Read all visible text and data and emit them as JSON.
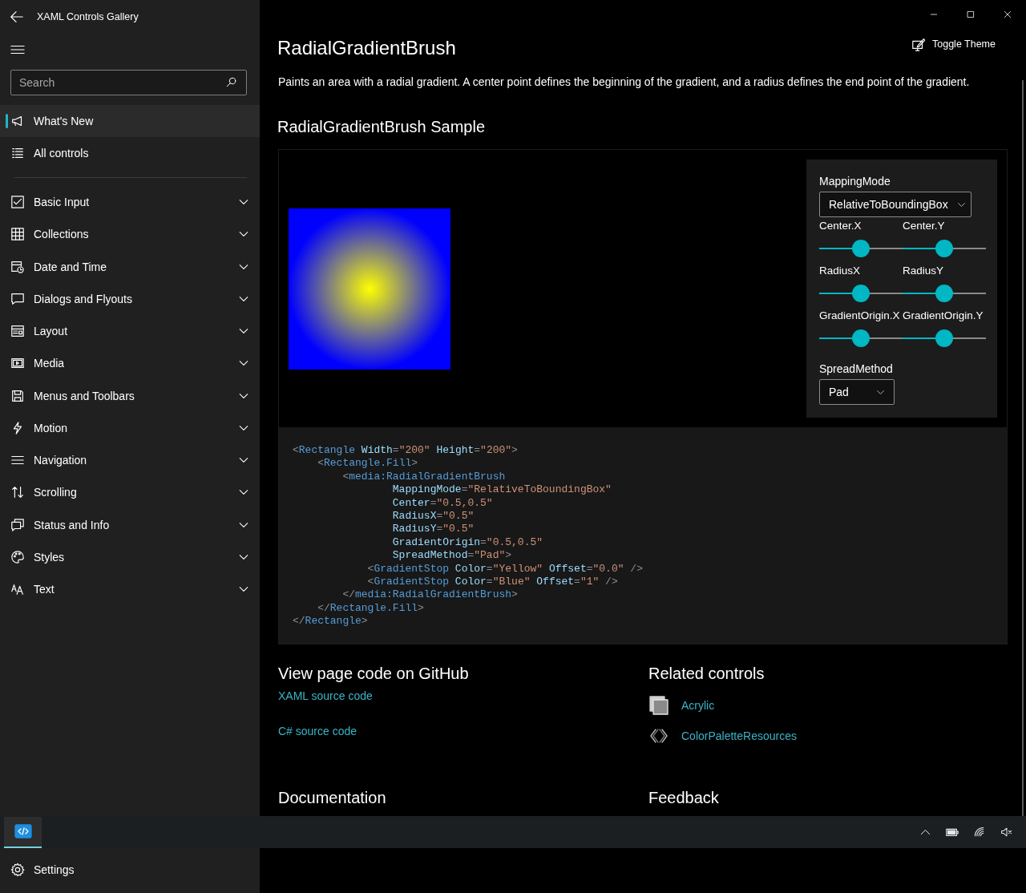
{
  "window": {
    "title": "XAML Controls Gallery"
  },
  "sidebar": {
    "search": {
      "placeholder": "Search"
    },
    "items": [
      {
        "label": "What's New",
        "selected": true
      },
      {
        "label": "All controls",
        "selected": false
      }
    ],
    "categories": [
      {
        "label": "Basic Input",
        "expanded": false,
        "selected": false
      },
      {
        "label": "Collections",
        "expanded": false,
        "selected": false
      },
      {
        "label": "Date and Time",
        "expanded": false,
        "selected": false
      },
      {
        "label": "Dialogs and Flyouts",
        "expanded": false,
        "selected": false
      },
      {
        "label": "Layout",
        "expanded": false,
        "selected": false
      },
      {
        "label": "Media",
        "expanded": false,
        "selected": false
      },
      {
        "label": "Menus and Toolbars",
        "expanded": false,
        "selected": false
      },
      {
        "label": "Motion",
        "expanded": false,
        "selected": false
      },
      {
        "label": "Navigation",
        "expanded": false,
        "selected": false
      },
      {
        "label": "Scrolling",
        "expanded": false,
        "selected": false
      },
      {
        "label": "Status and Info",
        "expanded": false,
        "selected": false
      },
      {
        "label": "Styles",
        "expanded": false,
        "selected": false
      },
      {
        "label": "Text",
        "expanded": false,
        "selected": false
      }
    ],
    "settings": {
      "label": "Settings"
    }
  },
  "page": {
    "title": "RadialGradientBrush",
    "toggle_theme": "Toggle Theme",
    "description": "Paints an area with a radial gradient. A center point defines the beginning of the gradient, and a radius defines the end point of the gradient.",
    "sample": {
      "heading": "RadialGradientBrush Sample",
      "options": {
        "mapping_mode": {
          "label": "MappingMode",
          "value": "RelativeToBoundingBox"
        },
        "sliders": [
          {
            "label": "Center.X",
            "level": 0.5
          },
          {
            "label": "Center.Y",
            "level": 0.5
          },
          {
            "label": "RadiusX",
            "level": 0.5
          },
          {
            "label": "RadiusY",
            "level": 0.5
          },
          {
            "label": "GradientOrigin.X",
            "level": 0.5
          },
          {
            "label": "GradientOrigin.Y",
            "level": 0.5
          }
        ],
        "spread_method": {
          "label": "SpreadMethod",
          "value": "Pad"
        }
      },
      "code": [
        [
          {
            "kind": "punct",
            "text": "<"
          },
          {
            "kind": "tag",
            "text": "Rectangle"
          },
          {
            "kind": "attr",
            "text": " Width"
          },
          {
            "kind": "punct",
            "text": "="
          },
          {
            "kind": "value",
            "text": "\"200\""
          },
          {
            "kind": "attr",
            "text": " Height"
          },
          {
            "kind": "punct",
            "text": "="
          },
          {
            "kind": "value",
            "text": "\"200\""
          },
          {
            "kind": "punct",
            "text": ">"
          }
        ],
        [
          {
            "kind": "punct",
            "text": "    <"
          },
          {
            "kind": "tag",
            "text": "Rectangle.Fill"
          },
          {
            "kind": "punct",
            "text": ">"
          }
        ],
        [
          {
            "kind": "punct",
            "text": "        <"
          },
          {
            "kind": "tag",
            "text": "media:RadialGradientBrush"
          }
        ],
        [
          {
            "kind": "attr",
            "text": "                MappingMode"
          },
          {
            "kind": "punct",
            "text": "="
          },
          {
            "kind": "value",
            "text": "\"RelativeToBoundingBox\""
          }
        ],
        [
          {
            "kind": "attr",
            "text": "                Center"
          },
          {
            "kind": "punct",
            "text": "="
          },
          {
            "kind": "value",
            "text": "\"0.5,0.5\""
          }
        ],
        [
          {
            "kind": "attr",
            "text": "                RadiusX"
          },
          {
            "kind": "punct",
            "text": "="
          },
          {
            "kind": "value",
            "text": "\"0.5\""
          }
        ],
        [
          {
            "kind": "attr",
            "text": "                RadiusY"
          },
          {
            "kind": "punct",
            "text": "="
          },
          {
            "kind": "value",
            "text": "\"0.5\""
          }
        ],
        [
          {
            "kind": "attr",
            "text": "                GradientOrigin"
          },
          {
            "kind": "punct",
            "text": "="
          },
          {
            "kind": "value",
            "text": "\"0.5,0.5\""
          }
        ],
        [
          {
            "kind": "attr",
            "text": "                SpreadMethod"
          },
          {
            "kind": "punct",
            "text": "="
          },
          {
            "kind": "value",
            "text": "\"Pad\""
          },
          {
            "kind": "punct",
            "text": ">"
          }
        ],
        [
          {
            "kind": "punct",
            "text": "            <"
          },
          {
            "kind": "tag",
            "text": "GradientStop"
          },
          {
            "kind": "attr",
            "text": " Color"
          },
          {
            "kind": "punct",
            "text": "="
          },
          {
            "kind": "value",
            "text": "\"Yellow\""
          },
          {
            "kind": "attr",
            "text": " Offset"
          },
          {
            "kind": "punct",
            "text": "="
          },
          {
            "kind": "value",
            "text": "\"0.0\""
          },
          {
            "kind": "punct",
            "text": " />"
          }
        ],
        [
          {
            "kind": "punct",
            "text": "            <"
          },
          {
            "kind": "tag",
            "text": "GradientStop"
          },
          {
            "kind": "attr",
            "text": " Color"
          },
          {
            "kind": "punct",
            "text": "="
          },
          {
            "kind": "value",
            "text": "\"Blue\""
          },
          {
            "kind": "attr",
            "text": " Offset"
          },
          {
            "kind": "punct",
            "text": "="
          },
          {
            "kind": "value",
            "text": "\"1\""
          },
          {
            "kind": "punct",
            "text": " />"
          }
        ],
        [
          {
            "kind": "punct",
            "text": "        </"
          },
          {
            "kind": "tag",
            "text": "media:RadialGradientBrush"
          },
          {
            "kind": "punct",
            "text": ">"
          }
        ],
        [
          {
            "kind": "punct",
            "text": "    </"
          },
          {
            "kind": "tag",
            "text": "Rectangle.Fill"
          },
          {
            "kind": "punct",
            "text": ">"
          }
        ],
        [
          {
            "kind": "punct",
            "text": "</"
          },
          {
            "kind": "tag",
            "text": "Rectangle"
          },
          {
            "kind": "punct",
            "text": ">"
          }
        ]
      ]
    },
    "github": {
      "heading": "View page code on GitHub",
      "links": [
        "XAML source code",
        "C# source code"
      ]
    },
    "related": {
      "heading": "Related controls",
      "items": [
        "Acrylic",
        "ColorPaletteResources"
      ]
    },
    "documentation": {
      "heading": "Documentation"
    },
    "feedback": {
      "heading": "Feedback"
    }
  }
}
